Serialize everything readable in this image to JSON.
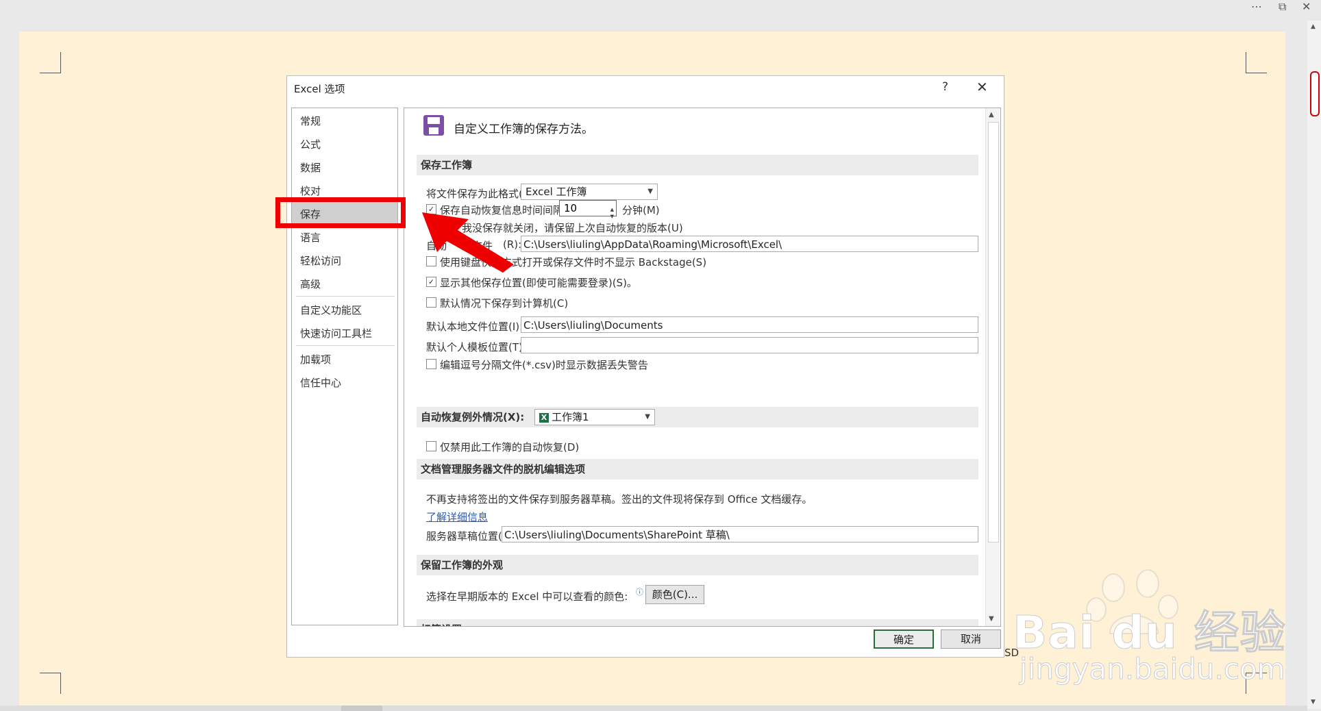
{
  "window": {
    "more_icon": "⋯",
    "restore_icon": "⧉",
    "close_icon": "✕"
  },
  "dialog": {
    "title": "Excel 选项",
    "help": "?",
    "close": "✕"
  },
  "nav": {
    "items": [
      {
        "label": "常规"
      },
      {
        "label": "公式"
      },
      {
        "label": "数据"
      },
      {
        "label": "校对"
      },
      {
        "label": "保存",
        "selected": true
      },
      {
        "label": "语言"
      },
      {
        "label": "轻松访问"
      },
      {
        "label": "高级"
      },
      {
        "label": "自定义功能区"
      },
      {
        "label": "快速访问工具栏"
      },
      {
        "label": "加载项"
      },
      {
        "label": "信任中心"
      }
    ]
  },
  "content": {
    "title": "自定义工作簿的保存方法。",
    "sections": {
      "save_workbook": "保存工作簿",
      "autorecover_exceptions": "自动恢复例外情况(X):",
      "offline_editing": "文档管理服务器文件的脱机编辑选项",
      "preserve_appearance": "保留工作簿的外观",
      "cut_off": "标签设置"
    },
    "save_format_label": "将文件保存为此格式(F):",
    "save_format_value": "Excel 工作簿",
    "autorecover_interval_label": "保存自动恢复信息时间间隔(A)",
    "autorecover_interval_checked": true,
    "autorecover_interval_value": "10",
    "minutes_label": "分钟(M)",
    "keep_last_label": "如果我没保存就关闭，请保留上次自动恢复的版本(U)",
    "keep_last_visible": "我没保存就关闭，请保留上次自动恢复的版本(U)",
    "autorecover_location_label": "自动恢复文件位置(R):",
    "autorecover_location_visible_a": "自动",
    "autorecover_location_visible_b": "复文件",
    "autorecover_location_visible_c": "(R):",
    "autorecover_location_value": "C:\\Users\\liuling\\AppData\\Roaming\\Microsoft\\Excel\\",
    "no_backstage_label": "使用键盘快捷方式打开或保存文件时不显示 Backstage(S)",
    "no_backstage_checked": false,
    "show_other_locations_label": "显示其他保存位置(即使可能需要登录)(S)。",
    "show_other_locations_checked": true,
    "save_to_computer_label": "默认情况下保存到计算机(C)",
    "save_to_computer_checked": false,
    "default_local_label": "默认本地文件位置(I):",
    "default_local_value": "C:\\Users\\liuling\\Documents",
    "default_template_label": "默认个人模板位置(T):",
    "default_template_value": "",
    "csv_warning_label": "编辑逗号分隔文件(*.csv)时显示数据丢失警告",
    "csv_warning_checked": false,
    "autorecover_workbook": "工作簿1",
    "xl_glyph": "X",
    "disable_autorecover_label": "仅禁用此工作簿的自动恢复(D)",
    "disable_autorecover_checked": false,
    "offline_note": "不再支持将签出的文件保存到服务器草稿。签出的文件现将保存到 Office 文档缓存。",
    "learn_more": "了解详细信息",
    "server_drafts_label": "服务器草稿位置(V):",
    "server_drafts_value": "C:\\Users\\liuling\\Documents\\SharePoint 草稿\\",
    "colors_label": "选择在早期版本的 Excel 中可以查看的颜色:",
    "info_icon": "ⓘ",
    "colors_button": "颜色(C)..."
  },
  "buttons": {
    "ok": "确定",
    "cancel": "取消"
  },
  "annotations": {
    "highlight_color": "#ee0000"
  },
  "watermark": {
    "text": "Bai du 经验",
    "url": "jingyan.baidu.com"
  },
  "misc": {
    "sd_text": "SD"
  }
}
